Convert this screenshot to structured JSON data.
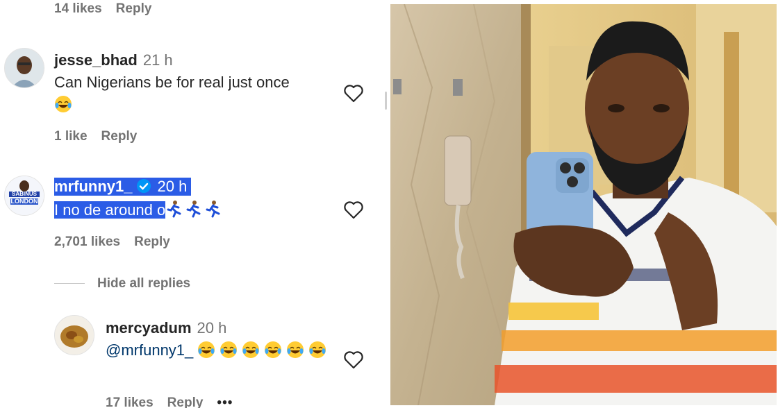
{
  "top_meta": {
    "likes": "14 likes",
    "reply": "Reply"
  },
  "comments": [
    {
      "username": "jesse_bhad",
      "time": "21 h",
      "text": "Can Nigerians be for real just once",
      "likes": "1 like",
      "reply": "Reply"
    },
    {
      "username": "mrfunny1_",
      "time": "20 h",
      "text": "I no de around o",
      "likes": "2,701 likes",
      "reply": "Reply",
      "avatar_text": {
        "line1": "SABINUS",
        "line2": "LONDON"
      }
    }
  ],
  "replies_toggle": "Hide all replies",
  "reply_comment": {
    "username": "mercyadum",
    "time": "20 h",
    "mention": "@mrfunny1_",
    "likes": "17 likes",
    "reply": "Reply",
    "more": "•••"
  },
  "colors": {
    "highlight": "#2b5ce6",
    "verified": "#0095f6",
    "muted": "#737373"
  }
}
